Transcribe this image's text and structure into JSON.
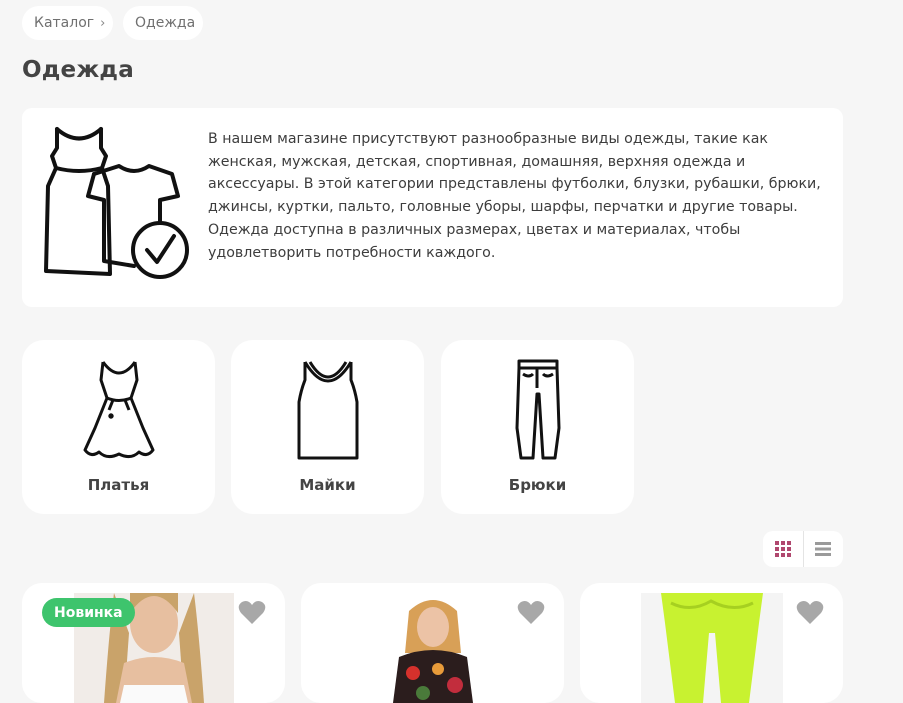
{
  "breadcrumb": {
    "items": [
      {
        "label": "Каталог"
      },
      {
        "label": "Одежда"
      }
    ]
  },
  "page": {
    "title": "Одежда"
  },
  "info": {
    "icon": "clothes-check-icon",
    "description": "В нашем магазине присутствуют разнообразные виды одежды, такие как женская, мужская, детская, спортивная, домашняя, верхняя одежда и аксессуары. В этой категории представлены футболки, блузки, рубашки, брюки, джинсы, куртки, пальто, головные уборы, шарфы, перчатки и другие товары. Одежда доступна в различных размерах, цветах и материалах, чтобы удовлетворить потребности каждого."
  },
  "categories": [
    {
      "label": "Платья",
      "icon": "dress-icon"
    },
    {
      "label": "Майки",
      "icon": "tank-top-icon"
    },
    {
      "label": "Брюки",
      "icon": "pants-icon"
    }
  ],
  "view_toggle": {
    "active": "grid",
    "active_color": "#b0476e",
    "inactive_color": "#9a9a9a"
  },
  "products": [
    {
      "badge": "Новинка",
      "favorite_icon": "heart-icon"
    },
    {
      "favorite_icon": "heart-icon"
    },
    {
      "favorite_icon": "heart-icon"
    }
  ],
  "colors": {
    "badge": "#3ec46d",
    "background": "#f6f6f6",
    "card": "#ffffff"
  }
}
